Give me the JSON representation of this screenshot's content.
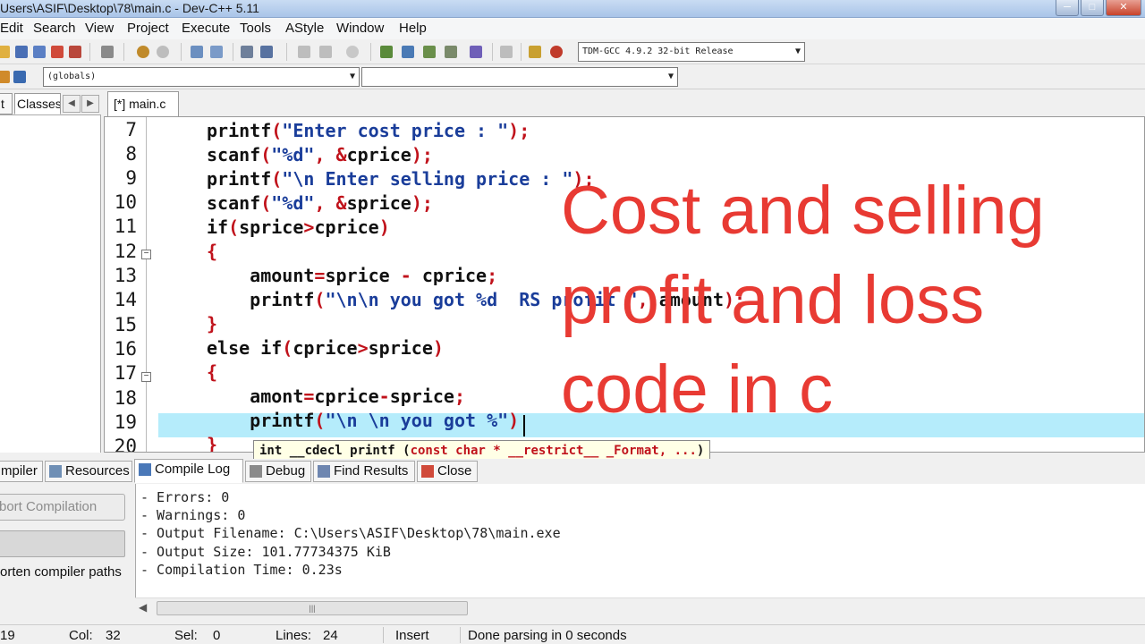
{
  "window": {
    "title": "Users\\ASIF\\Desktop\\78\\main.c - Dev-C++ 5.11"
  },
  "menu": [
    "Edit",
    "Search",
    "View",
    "Project",
    "Execute",
    "Tools",
    "AStyle",
    "Window",
    "Help"
  ],
  "toolbar": {
    "compiler_combo": "TDM-GCC 4.9.2 32-bit Release",
    "globals_combo": "(globals)",
    "functions_combo": ""
  },
  "left_tabs": {
    "project_fragment": "t",
    "classes": "Classes"
  },
  "editor": {
    "tab": "[*] main.c",
    "line_numbers": [
      "7",
      "8",
      "9",
      "10",
      "11",
      "12",
      "13",
      "14",
      "15",
      "16",
      "17",
      "18",
      "19",
      "20"
    ],
    "tooltip": {
      "prefix": "int __cdecl printf (",
      "params": "const char * __restrict__ _Format, ...",
      "suffix": ")"
    }
  },
  "caption": "Cost and selling\nprofit and loss\ncode in c",
  "bottom_tabs": [
    "mpiler",
    "Resources",
    "Compile Log",
    "Debug",
    "Find Results",
    "Close"
  ],
  "bottom_left": {
    "abort_button": "bort Compilation",
    "shorten_paths": "orten compiler paths"
  },
  "compile_log": [
    "- Errors: 0",
    "- Warnings: 0",
    "- Output Filename: C:\\Users\\ASIF\\Desktop\\78\\main.exe",
    "- Output Size: 101.77734375 KiB",
    "- Compilation Time: 0.23s"
  ],
  "status": {
    "line": "19",
    "col_label": "Col:",
    "col": "32",
    "sel_label": "Sel:",
    "sel": "0",
    "lines_label": "Lines:",
    "lines": "24",
    "mode": "Insert",
    "message": "Done parsing in 0 seconds"
  },
  "colors": {
    "caption": "#e83a33",
    "string": "#1a3d9a",
    "punct": "#c0121b",
    "highlight": "#b5ecfb"
  }
}
